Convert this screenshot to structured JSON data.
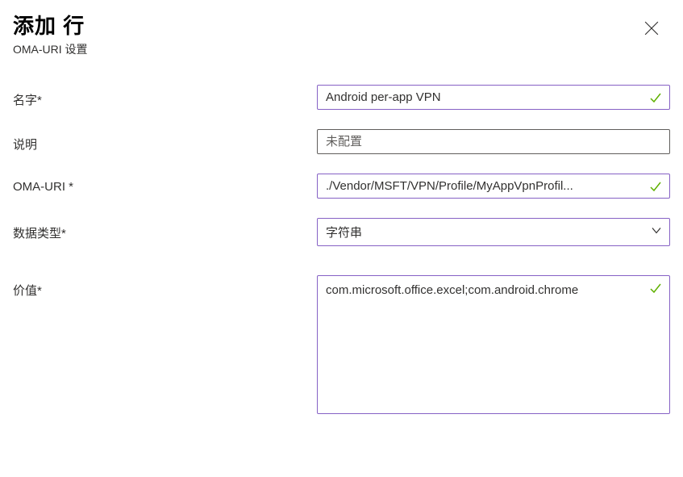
{
  "header": {
    "title": "添加 行",
    "subtitle": "OMA-URI 设置"
  },
  "fields": {
    "name_label": "名字*",
    "name_value": "Android per-app VPN",
    "desc_label": "说明",
    "desc_placeholder": "未配置",
    "omauri_label": "OMA-URI *",
    "omauri_value": "./Vendor/MSFT/VPN/Profile/MyAppVpnProfil...",
    "datatype_label": "数据类型*",
    "datatype_value": "字符串",
    "value_label": "价值*",
    "value_value": "com.microsoft.office.excel;com.android.chrome"
  }
}
